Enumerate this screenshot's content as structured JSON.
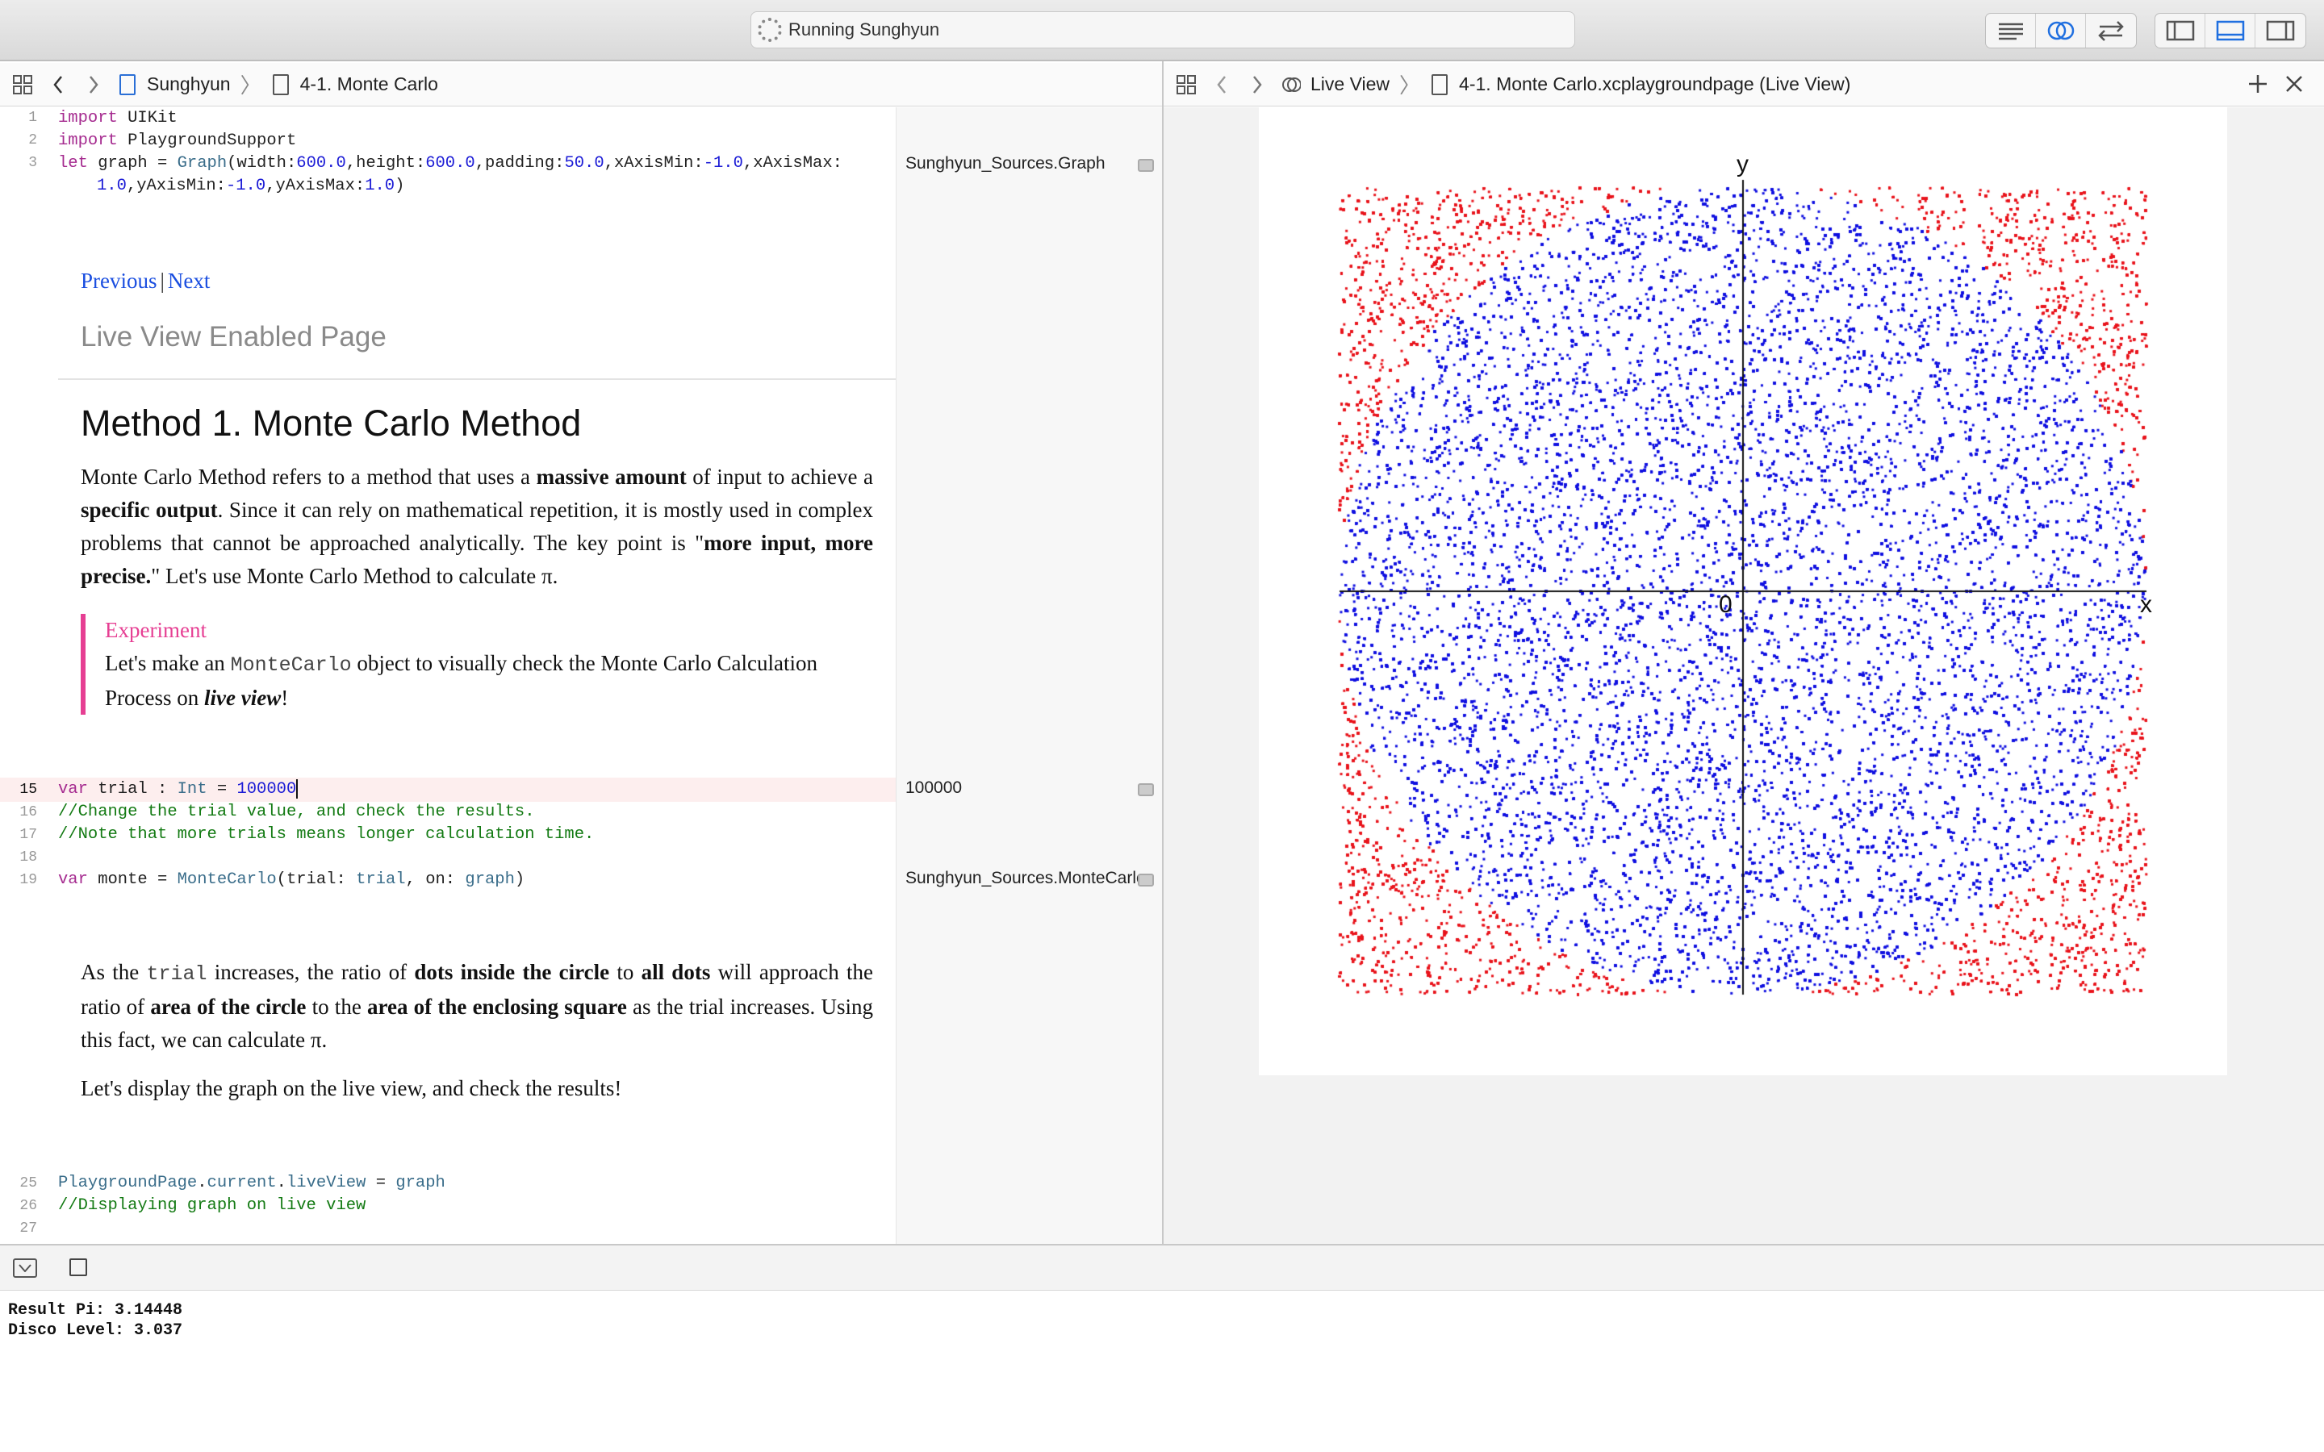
{
  "window": {
    "activity_text": "Running Sunghyun"
  },
  "left_jump": {
    "project": "Sunghyun",
    "page": "4-1. Monte Carlo"
  },
  "right_jump": {
    "category": "Live View",
    "file": "4-1. Monte Carlo.xcplaygroundpage (Live View)"
  },
  "code1": {
    "l1": {
      "n": "1",
      "a": "import",
      "b": " UIKit"
    },
    "l2": {
      "n": "2",
      "a": "import",
      "b": " PlaygroundSupport"
    },
    "l3": {
      "n": "3",
      "let": "let",
      "v": " graph = ",
      "t": "Graph",
      "p1": "(width:",
      "w": "600.0",
      "p2": ",height:",
      "h": "600.0",
      "p3": ",padding:",
      "pd": "50.0",
      "p4": ",xAxisMin:",
      "xmin": "-1.0",
      "p5": ",xAxisMax:"
    },
    "l3b": {
      "xmax": "1.0",
      "p6": ",yAxisMin:",
      "ymin": "-1.0",
      "p7": ",yAxisMax:",
      "ymax": "1.0",
      "p8": ")"
    }
  },
  "results": {
    "r3": "Sunghyun_Sources.Graph",
    "r15": "100000",
    "r19": "Sunghyun_Sources.MonteCarlo"
  },
  "doc1": {
    "previous": "Previous",
    "sep": "|",
    "next": "Next",
    "subtitle": "Live View Enabled Page",
    "heading": "Method 1. Monte Carlo Method",
    "p1a": "Monte Carlo Method refers to a method that uses a ",
    "p1b": "massive amount",
    "p1c": " of input to achieve a ",
    "p1d": "specific output",
    "p1e": ". Since it can rely on mathematical repetition, it is mostly used in complex problems that cannot be approached analytically. The key point is \"",
    "p1f": "more input, more precise.",
    "p1g": "\" Let's use Monte Carlo Method to calculate π.",
    "exp_title": "Experiment",
    "exp_a": "Let's make an ",
    "exp_code": "MonteCarlo",
    "exp_b": " object to visually check the Monte Carlo Calculation Process on ",
    "exp_c": "live view",
    "exp_d": "!"
  },
  "code2": {
    "l15": {
      "n": "15",
      "kw": "var",
      "a": " trial : ",
      "t": "Int",
      "b": " = ",
      "num": "100000"
    },
    "l16": {
      "n": "16",
      "c": "//Change the trial value, and check the results."
    },
    "l17": {
      "n": "17",
      "c": "//Note that more trials means longer calculation time."
    },
    "l18": {
      "n": "18"
    },
    "l19": {
      "n": "19",
      "kw": "var",
      "a": " monte = ",
      "t": "MonteCarlo",
      "b": "(trial: ",
      "v": "trial",
      "c": ", on: ",
      "g": "graph",
      "d": ")"
    }
  },
  "doc2": {
    "p1a": "As the ",
    "p1code": "trial",
    "p1b": " increases, the ratio of ",
    "p1c": "dots inside the circle",
    "p1d": " to ",
    "p1e": "all dots",
    "p1f": " will approach the ratio of ",
    "p1g": "area of the circle",
    "p1h": " to the ",
    "p1i": "area of the enclosing square",
    "p1j": " as the trial increases. Using this fact, we can calculate π.",
    "p2": "Let's display the graph on the live view, and check the results!"
  },
  "code3": {
    "l25": {
      "n": "25",
      "t": "PlaygroundPage",
      "a": ".",
      "b": "current",
      "c": ".",
      "d": "liveView",
      "e": " = ",
      "g": "graph"
    },
    "l26": {
      "n": "26",
      "c": "//Displaying graph on live view"
    },
    "l27": {
      "n": "27"
    }
  },
  "live_graph": {
    "x_label": "x",
    "y_label": "y",
    "origin_label": "0",
    "inside_color": "#1010e0",
    "outside_color": "#e8141c",
    "trial": 100000
  },
  "console": {
    "line1": "Result Pi: 3.14448",
    "line2": "Disco Level: 3.037"
  }
}
